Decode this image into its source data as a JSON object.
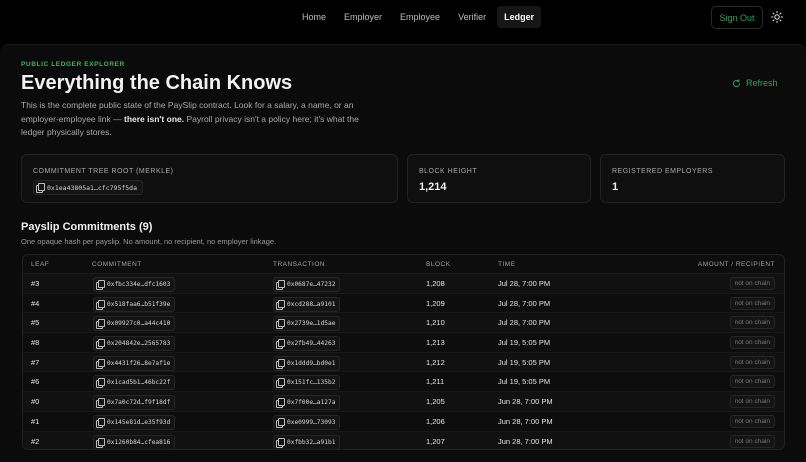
{
  "nav": {
    "items": [
      {
        "label": "Home",
        "active": false
      },
      {
        "label": "Employer",
        "active": false
      },
      {
        "label": "Employee",
        "active": false
      },
      {
        "label": "Verifier",
        "active": false
      },
      {
        "label": "Ledger",
        "active": true
      }
    ],
    "sign_out": "Sign Out",
    "theme_icon": "sun-icon"
  },
  "header": {
    "eyebrow": "PUBLIC LEDGER EXPLORER",
    "title": "Everything the Chain Knows",
    "refresh": "Refresh",
    "desc_a": "This is the complete public state of the PaySlip contract. Look for a salary, a name, or an employer-employee link — ",
    "desc_b": "there isn't one.",
    "desc_c": " Payroll privacy isn't a policy here; it's what the ledger physically stores."
  },
  "stats": {
    "root_label": "COMMITMENT TREE ROOT (MERKLE)",
    "root_value": "0x1ea43805a1…cfc795f5da",
    "height_label": "BLOCK HEIGHT",
    "height_value": "1,214",
    "employers_label": "REGISTERED EMPLOYERS",
    "employers_value": "1"
  },
  "commitments": {
    "title": "Payslip Commitments (9)",
    "subtitle": "One opaque hash per payslip. No amount, no recipient, no employer linkage.",
    "columns": [
      "LEAF",
      "COMMITMENT",
      "TRANSACTION",
      "BLOCK",
      "TIME",
      "AMOUNT / RECIPIENT"
    ],
    "rows": [
      {
        "leaf": "#3",
        "commitment": "0xfbc334e…dfc1603",
        "tx": "0x0687e…47232",
        "block": "1,208",
        "time": "Jul 28, 7:00 PM",
        "amount": "not on chain"
      },
      {
        "leaf": "#4",
        "commitment": "0x518faa6…b51f39e",
        "tx": "0xcd288…a9101",
        "block": "1,209",
        "time": "Jul 28, 7:00 PM",
        "amount": "not on chain"
      },
      {
        "leaf": "#5",
        "commitment": "0x09927c0…a44c410",
        "tx": "0x2739e…1d5ae",
        "block": "1,210",
        "time": "Jul 28, 7:00 PM",
        "amount": "not on chain"
      },
      {
        "leaf": "#8",
        "commitment": "0x204842e…2565783",
        "tx": "0x2fb49…44263",
        "block": "1,213",
        "time": "Jul 19, 5:05 PM",
        "amount": "not on chain"
      },
      {
        "leaf": "#7",
        "commitment": "0x4431f26…8e7af1e",
        "tx": "0x1ddd9…bd0e1",
        "block": "1,212",
        "time": "Jul 19, 5:05 PM",
        "amount": "not on chain"
      },
      {
        "leaf": "#6",
        "commitment": "0x1cad5b1…46bc22f",
        "tx": "0x151fc…135b2",
        "block": "1,211",
        "time": "Jul 19, 5:05 PM",
        "amount": "not on chain"
      },
      {
        "leaf": "#0",
        "commitment": "0x7a0c72d…f9f18df",
        "tx": "0x7f00e…a127a",
        "block": "1,205",
        "time": "Jun 28, 7:00 PM",
        "amount": "not on chain"
      },
      {
        "leaf": "#1",
        "commitment": "0x145e81d…e35f93d",
        "tx": "0xe0999…73093",
        "block": "1,206",
        "time": "Jun 28, 7:00 PM",
        "amount": "not on chain"
      },
      {
        "leaf": "#2",
        "commitment": "0x1260b84…cfea816",
        "tx": "0xfbb32…a91b1",
        "block": "1,207",
        "time": "Jun 28, 7:00 PM",
        "amount": "not on chain"
      }
    ]
  },
  "colors": {
    "accent": "#2fa25a",
    "background": "#000000"
  }
}
